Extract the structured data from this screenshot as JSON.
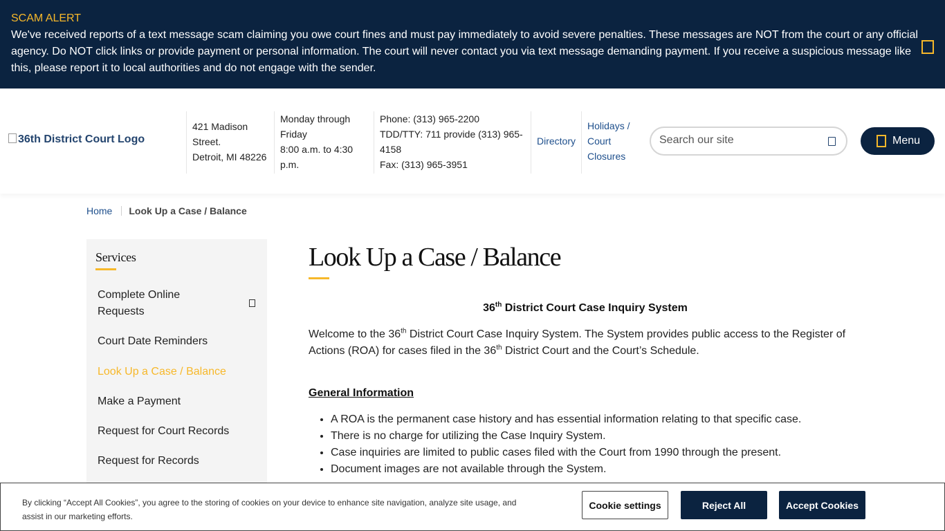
{
  "alert": {
    "title": "SCAM ALERT",
    "body": "We've received reports of a text message scam claiming you owe court fines and must pay immediately to avoid severe penalties. These messages are NOT from the court or any official agency. Do NOT click links or provide payment or personal information. The court will never contact you via text message demanding payment. If you receive a suspicious message like this, please report it to local authorities and do not engage with the sender."
  },
  "header": {
    "logo_alt": "36th District Court Logo",
    "address": [
      "421 Madison Street.",
      "Detroit, MI 48226"
    ],
    "hours": [
      "Monday through Friday",
      "8:00 a.m. to 4:30 p.m."
    ],
    "phone": [
      "Phone: (313) 965-2200",
      "TDD/TTY: 711 provide (313) 965-4158",
      "Fax: (313) 965-3951"
    ],
    "directory": "Directory",
    "holidays": "Holidays / Court Closures",
    "search_placeholder": "Search our site",
    "menu": "Menu"
  },
  "breadcrumb": {
    "home": "Home",
    "current": "Look Up a Case / Balance"
  },
  "sidebar": {
    "title": "Services",
    "items": [
      {
        "label": "Complete Online Requests"
      },
      {
        "label": "Court Date Reminders"
      },
      {
        "label": "Look Up a Case / Balance"
      },
      {
        "label": "Make a Payment"
      },
      {
        "label": "Request for Court Records"
      },
      {
        "label": "Request for Records"
      }
    ]
  },
  "main": {
    "title": "Look Up a Case / Balance",
    "subtitle_pre": "36",
    "subtitle_sup": "th",
    "subtitle_post": " District Court Case Inquiry System",
    "intro_1": "Welcome to the 36",
    "intro_sup1": "th",
    "intro_2": " District Court Case Inquiry System. The System provides public access to the Register of Actions (ROA) for cases filed in the 36",
    "intro_sup2": "th",
    "intro_3": " District Court and the Court’s Schedule.",
    "general_heading": "General Information",
    "general_items": [
      "A ROA is the permanent case history and has essential information relating to that specific case.",
      "There is no charge for utilizing the Case Inquiry System.",
      "Case inquiries are limited to public cases filed with the Court from 1990 through the present.",
      "Document images are not available through the System."
    ]
  },
  "cookie": {
    "text": "By clicking “Accept All Cookies”, you agree to the storing of cookies on your device to enhance site navigation, analyze site usage, and assist in our marketing efforts.",
    "settings": "Cookie settings",
    "reject": "Reject All",
    "accept": "Accept Cookies"
  },
  "colors": {
    "navy": "#0b2340",
    "gold": "#f7b82a",
    "link": "#1e4f8c"
  }
}
